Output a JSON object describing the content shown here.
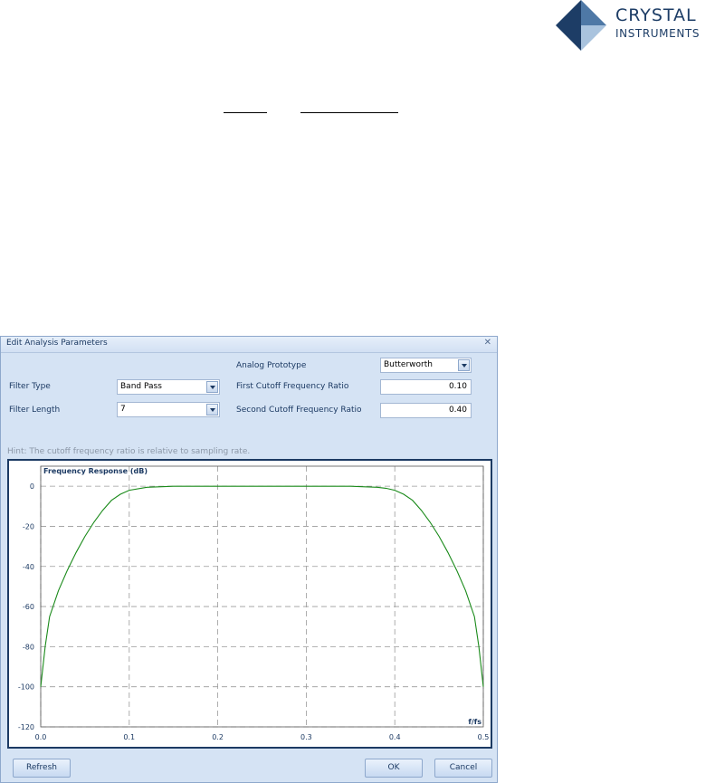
{
  "logo": {
    "line1": "CRYSTAL",
    "line2": "INSTRUMENTS",
    "colors": {
      "dark": "#1d3d66",
      "mid": "#4e78a6",
      "light": "#a9c3de"
    }
  },
  "dialog": {
    "title": "Edit Analysis Parameters",
    "close_icon": "close-icon",
    "analog_prototype": {
      "label": "Analog Prototype",
      "value": "Butterworth"
    },
    "filter_type": {
      "label": "Filter Type",
      "value": "Band Pass"
    },
    "filter_length": {
      "label": "Filter Length",
      "value": "7"
    },
    "first_cutoff": {
      "label": "First Cutoff Frequency Ratio",
      "value": "0.10"
    },
    "second_cutoff": {
      "label": "Second Cutoff Frequency Ratio",
      "value": "0.40"
    },
    "hint": "Hint: The cutoff frequency ratio is relative to sampling rate.",
    "buttons": {
      "refresh": "Refresh",
      "ok": "OK",
      "cancel": "Cancel"
    }
  },
  "chart_data": {
    "type": "line",
    "title": "Frequency Response (dB)",
    "xlabel": "f/fs",
    "ylabel": "",
    "xlim": [
      0.0,
      0.5
    ],
    "ylim": [
      -120,
      10
    ],
    "x_ticks": [
      "0.0",
      "0.1",
      "0.2",
      "0.3",
      "0.4",
      "0.5"
    ],
    "y_ticks": [
      "0",
      "-20",
      "-40",
      "-60",
      "-80",
      "-100",
      "-120"
    ],
    "grid": true,
    "series": [
      {
        "color": "#1a8a1a",
        "x": [
          0.0,
          0.005,
          0.01,
          0.02,
          0.03,
          0.04,
          0.05,
          0.06,
          0.07,
          0.08,
          0.09,
          0.1,
          0.12,
          0.15,
          0.2,
          0.25,
          0.3,
          0.35,
          0.38,
          0.39,
          0.4,
          0.41,
          0.42,
          0.43,
          0.44,
          0.45,
          0.46,
          0.47,
          0.48,
          0.49,
          0.495,
          0.5
        ],
        "y": [
          -100,
          -80,
          -65,
          -52,
          -42,
          -33,
          -25,
          -18,
          -12,
          -7,
          -4,
          -2,
          -0.5,
          0,
          0,
          0,
          0,
          0,
          -0.5,
          -1,
          -2,
          -4,
          -7,
          -12,
          -18,
          -25,
          -33,
          -42,
          -52,
          -65,
          -80,
          -100
        ]
      }
    ]
  }
}
